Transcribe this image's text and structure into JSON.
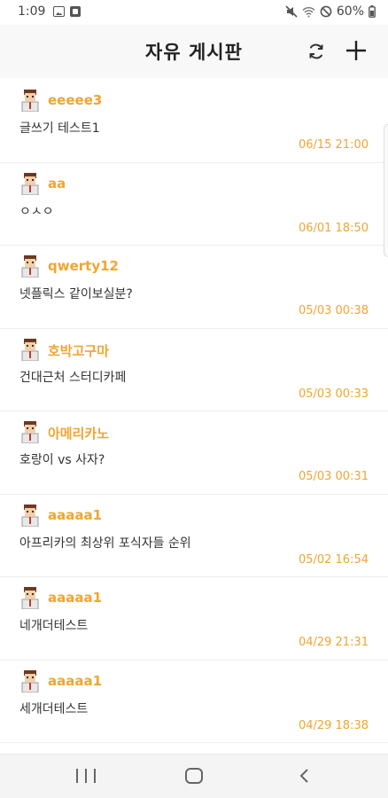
{
  "status_bar": {
    "time": "1:09",
    "battery": "60%"
  },
  "header": {
    "title": "자유 게시판",
    "refresh_icon": "refresh-icon",
    "add_icon": "plus-icon"
  },
  "posts": [
    {
      "author": "eeeee3",
      "title": "글쓰기 테스트1",
      "date": "06/15 21:00"
    },
    {
      "author": "aa",
      "title": "ㅇㅅㅇ",
      "date": "06/01 18:50"
    },
    {
      "author": "qwerty12",
      "title": "넷플릭스 같이보실분?",
      "date": "05/03 00:38"
    },
    {
      "author": "호박고구마",
      "title": "건대근처 스터디카페",
      "date": "05/03 00:33"
    },
    {
      "author": "아메리카노",
      "title": "호랑이 vs 사자?",
      "date": "05/03 00:31"
    },
    {
      "author": "aaaaa1",
      "title": "아프리카의 최상위 포식자들 순위",
      "date": "05/02 16:54"
    },
    {
      "author": "aaaaa1",
      "title": "네개더테스트",
      "date": "04/29 21:31"
    },
    {
      "author": "aaaaa1",
      "title": "세개더테스트",
      "date": "04/29 18:38"
    }
  ],
  "colors": {
    "accent": "#f0a531",
    "text": "#333333",
    "appbar": "#f8f8f8"
  },
  "nav_bar": {
    "recents_icon": "recents-icon",
    "home_icon": "home-icon",
    "back_icon": "back-icon"
  }
}
